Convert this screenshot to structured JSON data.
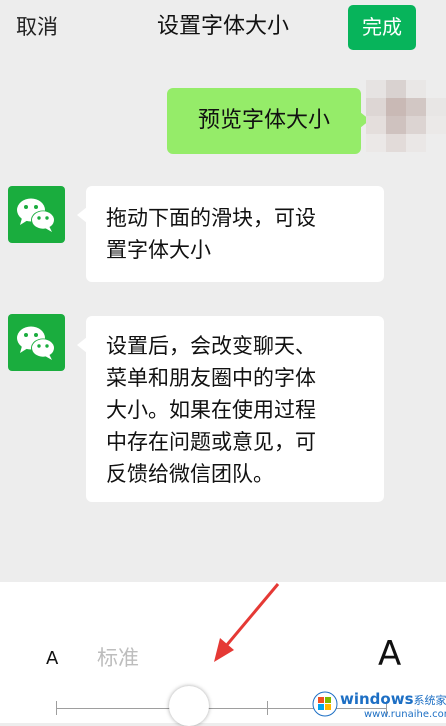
{
  "topbar": {
    "cancel_label": "取消",
    "title": "设置字体大小",
    "done_label": "完成"
  },
  "preview": {
    "text": "预览字体大小"
  },
  "messages": [
    {
      "lines": [
        "拖动下面的滑块，可设",
        "置字体大小"
      ]
    },
    {
      "lines": [
        "设置后，会改变聊天、",
        "菜单和朋友圈中的字体",
        "大小。如果在使用过程",
        "中存在问题或意见，可",
        "反馈给微信团队。"
      ]
    }
  ],
  "slider": {
    "small_label": "A",
    "standard_label": "标准",
    "large_label": "A",
    "tick_count": 7,
    "selected_index": 1
  },
  "watermark": {
    "brand": "windows",
    "cn": "系统家园",
    "url": "www.runaihe.com"
  },
  "colors": {
    "accent_green": "#07b45b",
    "outgoing_bubble": "#95ec69",
    "wechat_avatar": "#1aad3e",
    "annotation_red": "#e53935"
  },
  "icons": {
    "wechat_avatar": "wechat-logo-icon",
    "annotation": "red-arrow-icon",
    "watermark_logo": "windows-logo-icon"
  }
}
